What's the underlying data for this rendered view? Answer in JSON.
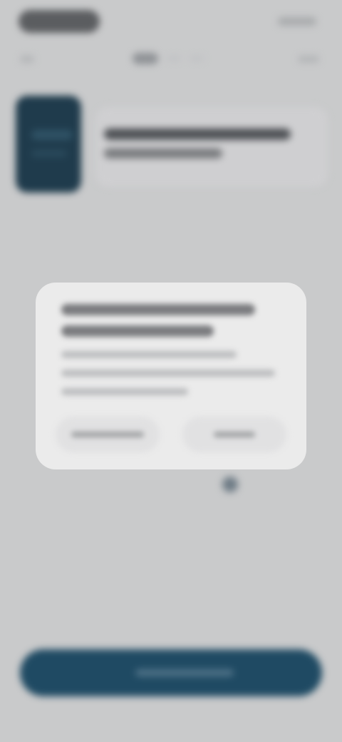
{
  "status_bar": {},
  "nav": {},
  "product": {
    "title": "",
    "subtitle": ""
  },
  "dialog": {
    "title": "",
    "body": "",
    "secondary_button_label": "",
    "primary_button_label": ""
  },
  "primary_button": {
    "label": ""
  },
  "colors": {
    "background": "#c9cacb",
    "dialog_surface": "#ebebeb",
    "primary_button": "#1f4a63",
    "product_thumbnail": "#1f3b4c"
  }
}
